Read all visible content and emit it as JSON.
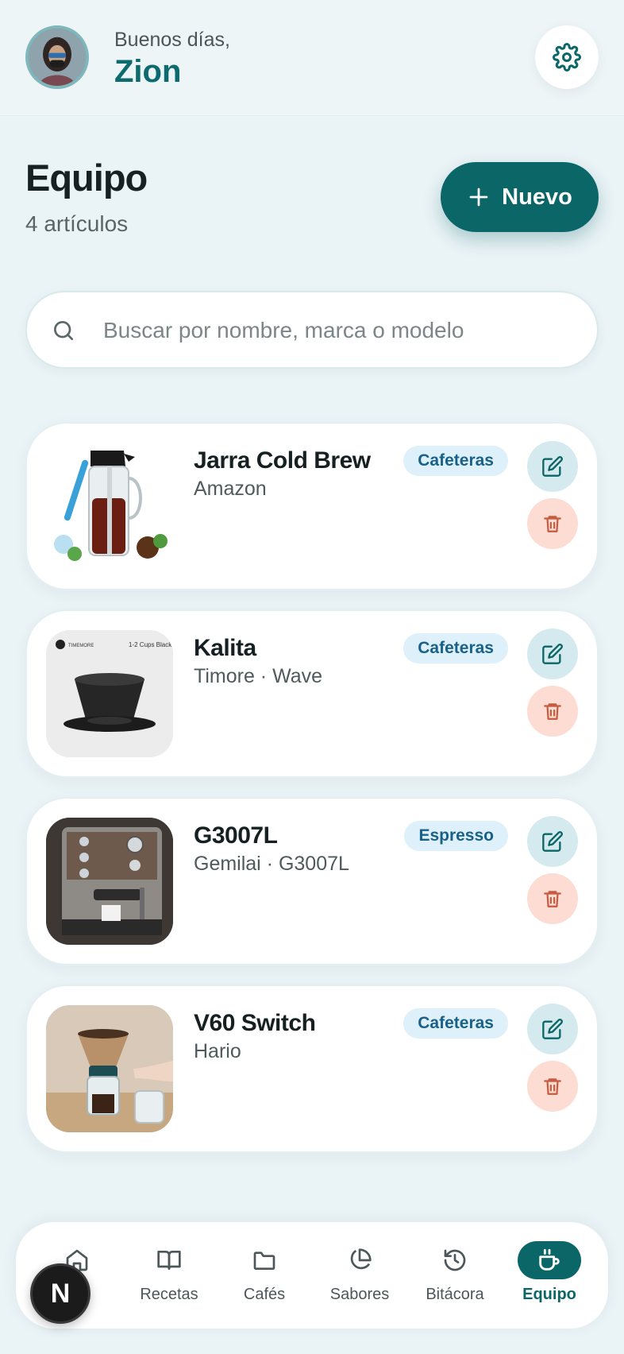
{
  "header": {
    "greeting": "Buenos días,",
    "username": "Zion",
    "avatar_icon": "user-avatar",
    "settings_icon": "gear-icon"
  },
  "page": {
    "title": "Equipo",
    "count": "4 artículos",
    "new_button": "Nuevo"
  },
  "search": {
    "placeholder": "Buscar por nombre, marca o modelo",
    "value": ""
  },
  "items": [
    {
      "name": "Jarra Cold Brew",
      "sub": "Amazon",
      "category": "Cafeteras",
      "image": "cold-brew-jar"
    },
    {
      "name": "Kalita",
      "sub": "Timore · Wave",
      "category": "Cafeteras",
      "image": "kalita-dripper"
    },
    {
      "name": "G3007L",
      "sub": "Gemilai · G3007L",
      "category": "Espresso",
      "image": "espresso-machine"
    },
    {
      "name": "V60 Switch",
      "sub": "Hario",
      "category": "Cafeteras",
      "image": "v60-switch"
    }
  ],
  "nav": [
    {
      "label": "o",
      "icon": "home-icon"
    },
    {
      "label": "Recetas",
      "icon": "book-icon"
    },
    {
      "label": "Cafés",
      "icon": "folder-icon"
    },
    {
      "label": "Sabores",
      "icon": "pie-chart-icon"
    },
    {
      "label": "Bitácora",
      "icon": "history-icon"
    },
    {
      "label": "Equipo",
      "icon": "coffee-cup-icon",
      "active": true
    }
  ],
  "overlay": {
    "letter": "N"
  },
  "kalita_thumb": {
    "brand": "TIMEMORE",
    "caption": "1-2 Cups Black"
  },
  "colors": {
    "accent": "#0b6668",
    "username": "#0d6b6f",
    "badge_bg": "#def0fa",
    "badge_text": "#196188",
    "edit_bg": "#d5eaee",
    "delete_bg": "#fcdcd3",
    "delete_icon": "#c75a3e"
  }
}
